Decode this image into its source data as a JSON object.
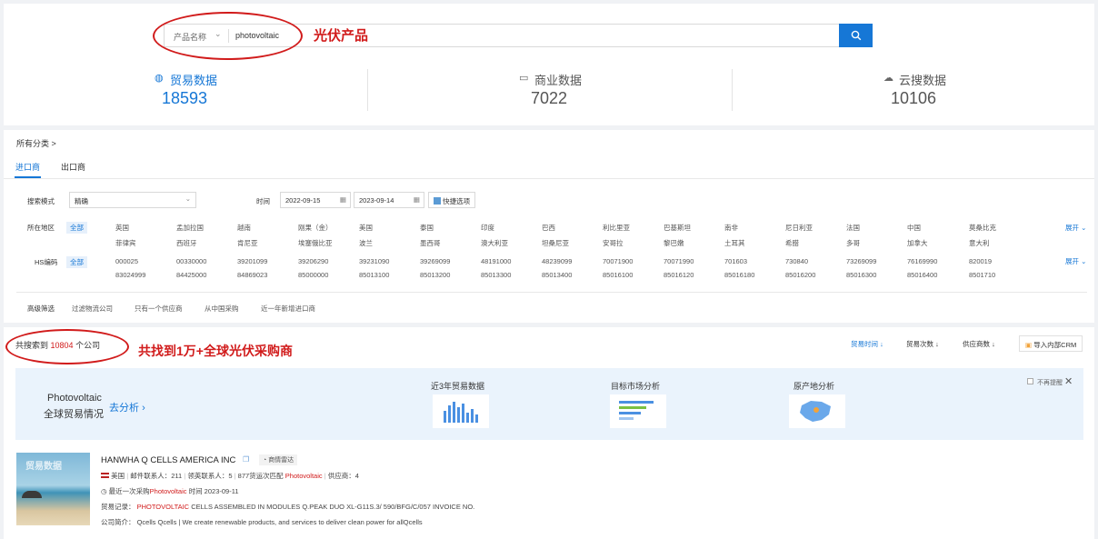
{
  "search": {
    "category": "产品名称",
    "query": "photovoltaic"
  },
  "annotations": {
    "product": "光伏产品",
    "result": "共找到1万+全球光伏采购商"
  },
  "stats": [
    {
      "label": "贸易数据",
      "value": "18593",
      "icon": "globe-icon",
      "active": true
    },
    {
      "label": "商业数据",
      "value": "7022",
      "icon": "monitor-icon",
      "active": false
    },
    {
      "label": "云搜数据",
      "value": "10106",
      "icon": "cloud-icon",
      "active": false
    }
  ],
  "breadcrumb": "所有分类 >",
  "tabs": [
    "进口商",
    "出口商"
  ],
  "filters": {
    "search_mode_label": "搜索模式",
    "search_mode_value": "精确",
    "time_label": "时间",
    "date_start": "2022-09-15",
    "date_end": "2023-09-14",
    "quick_option": "快捷选项",
    "region_label": "所在地区",
    "hs_label": "HS编码",
    "all": "全部",
    "expand": "展开",
    "regions_row1": [
      "英国",
      "孟加拉国",
      "越南",
      "刚果（金）",
      "美国",
      "泰国",
      "印度",
      "巴西",
      "利比里亚",
      "巴基斯坦",
      "南非",
      "尼日利亚",
      "法国",
      "中国",
      "莫桑比克"
    ],
    "regions_row2": [
      "菲律宾",
      "西班牙",
      "肯尼亚",
      "埃塞俄比亚",
      "波兰",
      "墨西哥",
      "澳大利亚",
      "坦桑尼亚",
      "安哥拉",
      "黎巴嫩",
      "土耳其",
      "希腊",
      "多哥",
      "加拿大",
      "意大利"
    ],
    "hs_row1": [
      "000025",
      "00330000",
      "39201099",
      "39206290",
      "39231090",
      "39269099",
      "48191000",
      "48239099",
      "70071900",
      "70071990",
      "701603",
      "730840",
      "73269099",
      "76169990",
      "820019"
    ],
    "hs_row2": [
      "83024999",
      "84425000",
      "84869023",
      "85000000",
      "85013100",
      "85013200",
      "85013300",
      "85013400",
      "85016100",
      "85016120",
      "85016180",
      "85016200",
      "85016300",
      "85016400",
      "8501710"
    ],
    "advanced_label": "高级筛选",
    "advanced_options": [
      "过滤物流公司",
      "只有一个供应商",
      "从中国采购",
      "近一年新增进口商"
    ]
  },
  "results": {
    "prefix": "共搜索到",
    "count": "10804",
    "suffix": "个公司",
    "sort": [
      "贸易时间",
      "贸易次数",
      "供应商数"
    ],
    "import_crm": "导入内部CRM"
  },
  "banner": {
    "title_en": "Photovoltaic",
    "title_cn": "全球贸易情况",
    "go_analyze": "去分析",
    "cards": [
      "近3年贸易数据",
      "目标市场分析",
      "原产地分析"
    ],
    "dismiss": "不再提醒"
  },
  "company": {
    "name": "HANWHA Q CELLS AMERICA INC",
    "tag": "商情雷达",
    "country": "美国",
    "email_contacts": "邮件联系人：211",
    "linkedin_contacts": "领英联系人：5",
    "waybill_prefix": "877货运次匹配",
    "waybill_keyword": "Photovoltaic",
    "suppliers": "供应商：4",
    "last_purchase_prefix": "最近一次采购",
    "last_purchase_keyword": "Photovoltaic",
    "last_purchase_suffix": "时间 2023-09-11",
    "trade_label": "贸易记录：",
    "trade_keyword": "PHOTOVOLTAIC",
    "trade_text": "CELLS ASSEMBLED IN MODULES Q.PEAK DUO XL-G11S.3/ 590/BFG/C/057 INVOICE NO.",
    "intro_label": "公司简介：",
    "intro_text": "Qcells Qcells | We create renewable products, and services to deliver clean power for allQcells",
    "thumb_text": "贸易数据"
  },
  "colors": {
    "accent": "#1677d6",
    "annotation": "#d11b1b",
    "keyword": "#d11b1b"
  }
}
